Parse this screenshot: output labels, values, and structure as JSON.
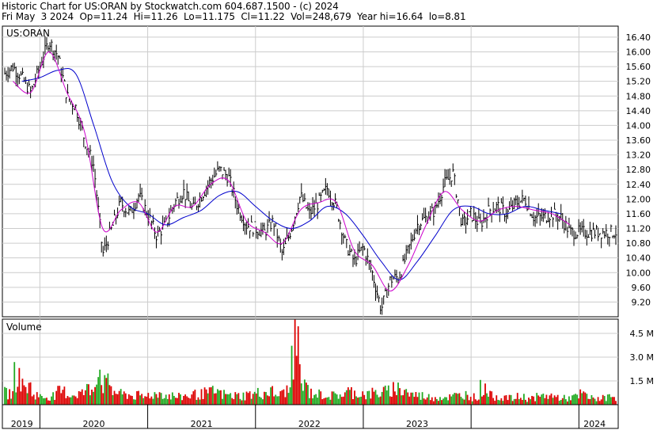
{
  "header": {
    "line1": "Historic Chart for US:ORAN by Stockwatch.com 604.687.1500 - (c) 2024",
    "line2": "Fri May  3 2024  Op=11.24  Hi=11.26  Lo=11.175  Cl=11.22  Vol=248,679  Year hi=16.64  lo=8.81"
  },
  "price_panel": {
    "label": "US:ORAN"
  },
  "volume_panel": {
    "label": "Volume"
  },
  "colors": {
    "price_bar": "#000000",
    "ma_short": "#cc00cc",
    "ma_long": "#0000cc",
    "volume_up": "#22aa22",
    "volume_down": "#dd0000",
    "grid": "#cccccc",
    "frame": "#000000"
  },
  "chart_data": [
    {
      "type": "line",
      "title": "",
      "series": [
        {
          "name": "",
          "points": [
            [
              "2018-09",
              15.4
            ],
            [
              "2018-10",
              15.6
            ],
            [
              "2018-11",
              15.3
            ],
            [
              "2018-12",
              14.9
            ],
            [
              "2019-01",
              15.6
            ],
            [
              "2019-02",
              16.3
            ],
            [
              "2019-03",
              15.9
            ],
            [
              "2019-04",
              14.8
            ],
            [
              "2019-05",
              14.5
            ],
            [
              "2019-06",
              13.6
            ],
            [
              "2019-07",
              12.9
            ],
            [
              "2019-08",
              10.5
            ],
            [
              "2019-09",
              11.2
            ],
            [
              "2019-10",
              11.9
            ],
            [
              "2019-11",
              11.6
            ],
            [
              "2019-12",
              12.1
            ],
            [
              "2020-01",
              11.6
            ],
            [
              "2020-02",
              11.0
            ],
            [
              "2020-03",
              11.3
            ],
            [
              "2020-04",
              11.9
            ],
            [
              "2020-05",
              12.2
            ],
            [
              "2020-06",
              11.7
            ],
            [
              "2020-07",
              12.1
            ],
            [
              "2020-08",
              12.5
            ],
            [
              "2020-09",
              12.8
            ],
            [
              "2020-10",
              12.6
            ],
            [
              "2020-11",
              11.8
            ],
            [
              "2020-12",
              11.3
            ],
            [
              "2021-01",
              11.2
            ],
            [
              "2021-02",
              11.1
            ],
            [
              "2021-03",
              11.4
            ],
            [
              "2021-04",
              10.5
            ],
            [
              "2021-05",
              11.2
            ],
            [
              "2021-06",
              12.1
            ],
            [
              "2021-07",
              11.6
            ],
            [
              "2021-08",
              11.9
            ],
            [
              "2021-09",
              12.3
            ],
            [
              "2021-10",
              11.8
            ],
            [
              "2021-11",
              10.8
            ],
            [
              "2021-12",
              10.3
            ],
            [
              "2022-01",
              10.7
            ],
            [
              "2022-02",
              10.0
            ],
            [
              "2022-03",
              9.0
            ],
            [
              "2022-04",
              9.8
            ],
            [
              "2022-05",
              9.9
            ],
            [
              "2022-06",
              10.6
            ],
            [
              "2022-07",
              11.3
            ],
            [
              "2022-08",
              11.5
            ],
            [
              "2022-09",
              11.7
            ],
            [
              "2022-10",
              12.4
            ],
            [
              "2022-11",
              12.7
            ],
            [
              "2022-12",
              11.3
            ],
            [
              "2023-01",
              11.6
            ],
            [
              "2023-02",
              11.3
            ],
            [
              "2023-03",
              11.7
            ],
            [
              "2023-04",
              11.8
            ],
            [
              "2023-05",
              11.6
            ],
            [
              "2023-06",
              11.9
            ],
            [
              "2023-07",
              12.0
            ],
            [
              "2023-08",
              11.5
            ],
            [
              "2023-09",
              11.5
            ],
            [
              "2023-10",
              11.6
            ],
            [
              "2023-11",
              11.5
            ],
            [
              "2023-12",
              11.1
            ]
          ]
        },
        {
          "name": "",
          "color": "#cc00cc",
          "points": [
            [
              "2018-10",
              15.2
            ],
            [
              "2018-12",
              14.9
            ],
            [
              "2019-02",
              16.0
            ],
            [
              "2019-04",
              14.9
            ],
            [
              "2019-06",
              13.8
            ],
            [
              "2019-08",
              11.2
            ],
            [
              "2019-10",
              11.7
            ],
            [
              "2019-12",
              11.9
            ],
            [
              "2020-02",
              11.1
            ],
            [
              "2020-04",
              11.8
            ],
            [
              "2020-06",
              11.8
            ],
            [
              "2020-08",
              12.4
            ],
            [
              "2020-10",
              12.5
            ],
            [
              "2020-12",
              11.4
            ],
            [
              "2021-02",
              11.1
            ],
            [
              "2021-04",
              10.8
            ],
            [
              "2021-06",
              11.7
            ],
            [
              "2021-08",
              11.9
            ],
            [
              "2021-10",
              11.9
            ],
            [
              "2021-12",
              10.6
            ],
            [
              "2022-02",
              10.2
            ],
            [
              "2022-04",
              9.5
            ],
            [
              "2022-06",
              10.2
            ],
            [
              "2022-08",
              11.3
            ],
            [
              "2022-10",
              12.2
            ],
            [
              "2022-12",
              11.7
            ],
            [
              "2023-02",
              11.4
            ],
            [
              "2023-04",
              11.7
            ],
            [
              "2023-06",
              11.8
            ],
            [
              "2023-08",
              11.7
            ],
            [
              "2023-10",
              11.6
            ],
            [
              "2023-12",
              11.3
            ]
          ]
        },
        {
          "name": "",
          "color": "#0000cc",
          "points": [
            [
              "2018-11",
              15.2
            ],
            [
              "2019-01",
              15.3
            ],
            [
              "2019-03",
              15.5
            ],
            [
              "2019-05",
              15.4
            ],
            [
              "2019-07",
              14.0
            ],
            [
              "2019-09",
              12.5
            ],
            [
              "2019-11",
              11.8
            ],
            [
              "2020-01",
              11.6
            ],
            [
              "2020-03",
              11.3
            ],
            [
              "2020-05",
              11.5
            ],
            [
              "2020-07",
              11.7
            ],
            [
              "2020-09",
              12.1
            ],
            [
              "2020-11",
              12.2
            ],
            [
              "2021-01",
              11.8
            ],
            [
              "2021-03",
              11.4
            ],
            [
              "2021-05",
              11.2
            ],
            [
              "2021-07",
              11.4
            ],
            [
              "2021-09",
              11.8
            ],
            [
              "2021-11",
              11.6
            ],
            [
              "2022-01",
              11.0
            ],
            [
              "2022-03",
              10.3
            ],
            [
              "2022-05",
              9.8
            ],
            [
              "2022-07",
              10.3
            ],
            [
              "2022-09",
              11.0
            ],
            [
              "2022-11",
              11.7
            ],
            [
              "2023-01",
              11.8
            ],
            [
              "2023-03",
              11.6
            ],
            [
              "2023-05",
              11.6
            ],
            [
              "2023-07",
              11.8
            ],
            [
              "2023-09",
              11.7
            ],
            [
              "2023-11",
              11.6
            ]
          ]
        }
      ],
      "y_ticks": [
        "16.40",
        "16.00",
        "15.60",
        "15.20",
        "14.80",
        "14.40",
        "14.00",
        "13.60",
        "13.20",
        "12.80",
        "12.40",
        "12.00",
        "11.60",
        "11.20",
        "10.80",
        "10.40",
        "10.00",
        "9.60",
        "9.20"
      ],
      "ylim": [
        8.8,
        16.7
      ],
      "x_ticks": [
        "2019",
        "2020",
        "2021",
        "2022",
        "2023",
        "2024"
      ],
      "grid": true
    },
    {
      "type": "bar",
      "title": "",
      "y_ticks": [
        "4.5 M",
        "3.0 M",
        "1.5 M"
      ],
      "ylim": [
        0,
        5.4
      ],
      "unit": "M",
      "volume_profile_m": [
        0.9,
        2.2,
        1.4,
        0.8,
        0.6,
        0.7,
        1.0,
        0.8,
        0.9,
        1.2,
        2.6,
        1.6,
        1.0,
        0.8,
        0.7,
        0.6,
        0.8,
        0.9,
        0.7,
        0.6,
        0.7,
        0.8,
        0.9,
        1.0,
        0.8,
        0.7,
        0.7,
        0.8,
        0.9,
        1.0,
        0.8,
        1.1,
        4.3,
        1.4,
        0.9,
        0.8,
        0.7,
        0.8,
        1.0,
        0.9,
        0.8,
        0.9,
        1.0,
        1.3,
        1.1,
        0.8,
        0.7,
        0.6,
        0.6,
        0.6,
        0.7,
        0.8,
        0.6,
        1.3,
        0.7,
        0.6,
        0.5,
        0.6,
        0.5,
        0.6,
        0.7,
        0.6,
        0.5,
        0.6,
        0.8,
        0.5,
        0.5,
        0.6
      ],
      "grid": true
    }
  ]
}
